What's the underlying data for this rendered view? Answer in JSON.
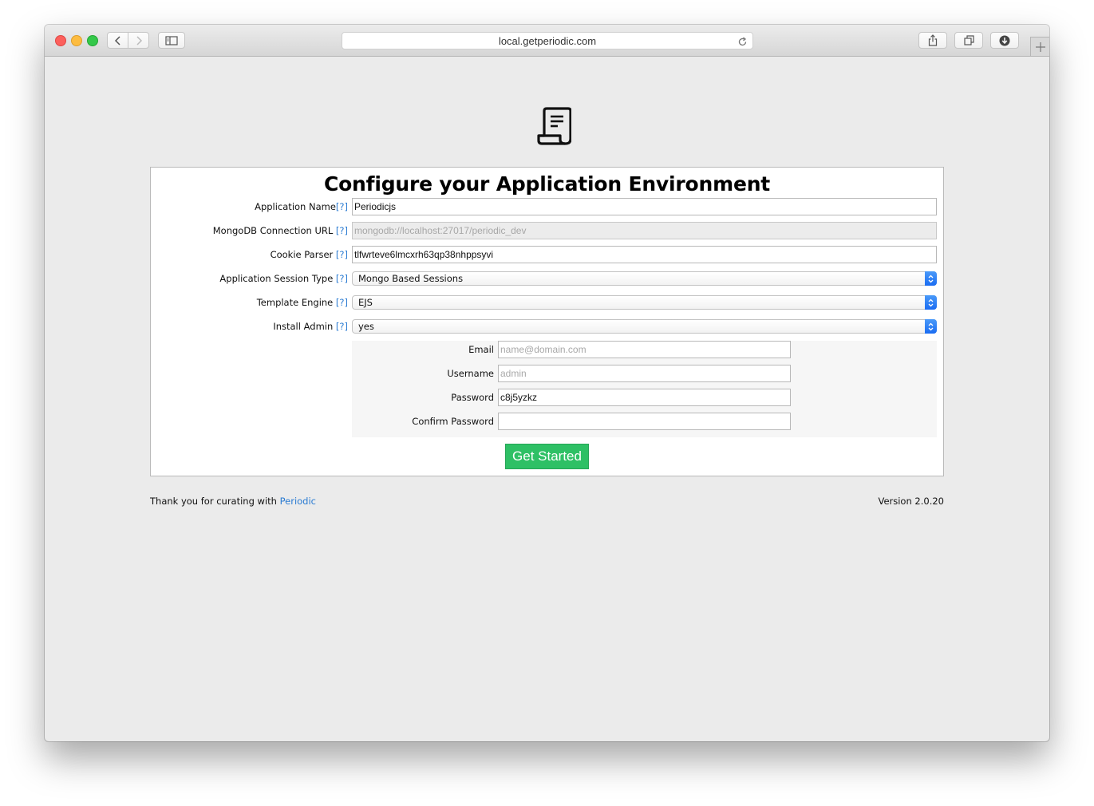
{
  "browser": {
    "url": "local.getperiodic.com",
    "icons": {
      "back": "chevron-left-icon",
      "forward": "chevron-right-icon",
      "sidebar": "sidebar-icon",
      "reload": "reload-icon",
      "share": "share-icon",
      "tabs": "tabs-icon",
      "downloads": "download-icon",
      "new_tab": "plus-icon"
    }
  },
  "page": {
    "logo_icon": "receipt-scroll-icon",
    "title": "Configure your Application Environment",
    "help_text": "[?]",
    "fields": {
      "app_name": {
        "label": "Application Name",
        "value": "Periodicjs"
      },
      "mongo_url": {
        "label": "MongoDB Connection URL ",
        "placeholder": "mongodb://localhost:27017/periodic_dev"
      },
      "cookie_parser": {
        "label": "Cookie Parser ",
        "value": "tlfwrteve6lmcxrh63qp38nhppsyvi"
      },
      "session_type": {
        "label": "Application Session Type ",
        "value": "Mongo Based Sessions"
      },
      "template_engine": {
        "label": "Template Engine ",
        "value": "EJS"
      },
      "install_admin": {
        "label": "Install Admin ",
        "value": "yes"
      }
    },
    "admin": {
      "email": {
        "label": "Email",
        "placeholder": "name@domain.com"
      },
      "username": {
        "label": "Username",
        "placeholder": "admin"
      },
      "password": {
        "label": "Password",
        "value": "c8j5yzkz"
      },
      "confirm_password": {
        "label": "Confirm Password",
        "value": ""
      }
    },
    "submit_label": "Get Started",
    "footer": {
      "thanks_prefix": "Thank you for curating with ",
      "thanks_link": "Periodic",
      "version": "Version 2.0.20"
    }
  },
  "colors": {
    "accent_button": "#2ec065",
    "link": "#2a7bd2",
    "select_arrow": "#1a6cf2"
  }
}
